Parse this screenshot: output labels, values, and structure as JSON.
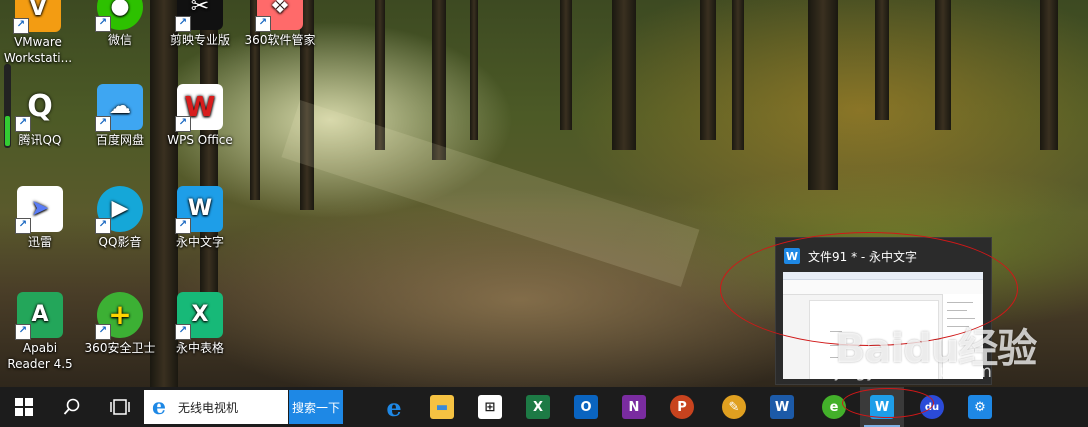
{
  "desktop": {
    "icons": [
      {
        "label": "VMware\nWorkstati...",
        "color": "#f39c12",
        "glyph": "V"
      },
      {
        "label": "微信",
        "color": "#2dc100",
        "glyph": "●"
      },
      {
        "label": "剪映专业版",
        "color": "#111111",
        "glyph": "✂"
      },
      {
        "label": "360软件管家",
        "color": "#ff6a6a",
        "glyph": "❖"
      },
      {
        "label": "腾讯QQ",
        "color": "#222222",
        "glyph": "Q"
      },
      {
        "label": "百度网盘",
        "color": "#3ea6f2",
        "glyph": "☁"
      },
      {
        "label": "WPS Office",
        "color": "#d71d1d",
        "glyph": "W"
      },
      {
        "label": "迅雷",
        "color": "#5a7cf5",
        "glyph": "➤"
      },
      {
        "label": "QQ影音",
        "color": "#15a7d8",
        "glyph": "▶"
      },
      {
        "label": "永中文字",
        "color": "#1e9ee8",
        "glyph": "W"
      },
      {
        "label": "Apabi\nReader 4.5",
        "color": "#23a65a",
        "glyph": "A"
      },
      {
        "label": "360安全卫士",
        "color": "#3cb034",
        "glyph": "+"
      },
      {
        "label": "永中表格",
        "color": "#17b978",
        "glyph": "X"
      }
    ]
  },
  "taskbar": {
    "search": {
      "value": "无线电视机",
      "button_label": "搜索一下"
    },
    "apps": [
      {
        "name": "edge",
        "color": "#1e88e5",
        "glyph": "e"
      },
      {
        "name": "file-explorer",
        "color": "#f5c242",
        "glyph": "▬"
      },
      {
        "name": "store",
        "color": "#2b2b2b",
        "glyph": "⊞"
      },
      {
        "name": "excel",
        "color": "#1d7a45",
        "glyph": "X"
      },
      {
        "name": "outlook",
        "color": "#0a64c0",
        "glyph": "O"
      },
      {
        "name": "onenote",
        "color": "#7a2ca0",
        "glyph": "N"
      },
      {
        "name": "powerpoint",
        "color": "#c8431e",
        "glyph": "P"
      },
      {
        "name": "paint",
        "color": "#e0a020",
        "glyph": "✎"
      },
      {
        "name": "word",
        "color": "#1c5aa8",
        "glyph": "W"
      },
      {
        "name": "360-browser",
        "color": "#43b02a",
        "glyph": "e"
      },
      {
        "name": "yozo-writer",
        "color": "#1e9ee8",
        "glyph": "W"
      },
      {
        "name": "baidu",
        "color": "#2b4bd8",
        "glyph": "du"
      },
      {
        "name": "settings",
        "color": "#1e88e5",
        "glyph": "⚙"
      }
    ]
  },
  "preview": {
    "title": "文件91 * - 永中文字"
  },
  "watermark": {
    "brand": "Baidu经验",
    "url": "jingyan.baidu.com"
  }
}
